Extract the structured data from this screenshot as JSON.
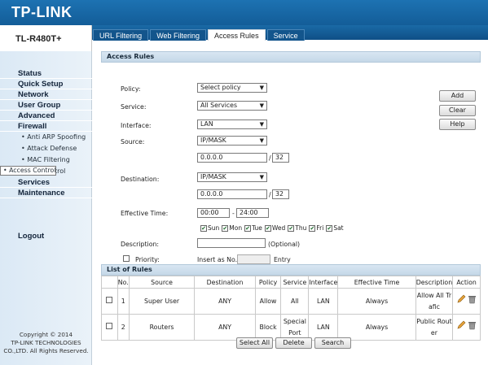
{
  "brand": {
    "logo": "TP-LINK",
    "model": "TL-R480T+"
  },
  "tabs": [
    "URL Filtering",
    "Web Filtering",
    "Access Rules",
    "Service"
  ],
  "sidebar": {
    "items": [
      {
        "label": "Status"
      },
      {
        "label": "Quick Setup"
      },
      {
        "label": "Network"
      },
      {
        "label": "User Group"
      },
      {
        "label": "Advanced"
      },
      {
        "label": "Firewall"
      },
      {
        "label": "• Anti ARP Spoofing"
      },
      {
        "label": "• Attack Defense"
      },
      {
        "label": "• MAC Filtering"
      },
      {
        "label": "• Access Control"
      },
      {
        "label": "• App Control"
      },
      {
        "label": "Services"
      },
      {
        "label": "Maintenance"
      }
    ],
    "logout": "Logout",
    "copyright": [
      "Copyright © 2014",
      "TP-LINK TECHNOLOGIES",
      "CO.,LTD. All Rights Reserved."
    ]
  },
  "access_rules": {
    "title": "Access Rules",
    "policy_label": "Policy:",
    "policy_value": "Select policy",
    "service_label": "Service:",
    "service_value": "All Services",
    "interface_label": "Interface:",
    "interface_value": "LAN",
    "source_label": "Source:",
    "source_type": "IP/MASK",
    "source_ip": "0.0.0.0",
    "source_mask": "32",
    "dest_label": "Destination:",
    "dest_type": "IP/MASK",
    "dest_ip": "0.0.0.0",
    "dest_mask": "32",
    "slash": "/",
    "time_label": "Effective Time:",
    "time_start": "00:00",
    "time_dash": "-",
    "time_end": "24:00",
    "days": [
      "Sun",
      "Mon",
      "Tue",
      "Wed",
      "Thu",
      "Fri",
      "Sat"
    ],
    "desc_label": "Description:",
    "desc_optional": "(Optional)",
    "priority_label": "Priority:",
    "insert_label": "Insert as No.",
    "entry_label": "Entry",
    "buttons": {
      "add": "Add",
      "clear": "Clear",
      "help": "Help"
    }
  },
  "rules": {
    "title": "List of Rules",
    "headers": [
      "No.",
      "Source",
      "Destination",
      "Policy",
      "Service",
      "Interface",
      "Effective Time",
      "Description",
      "Action"
    ],
    "rows": [
      {
        "no": "1",
        "source": "Super User",
        "destination": "ANY",
        "policy": "Allow",
        "service": "All",
        "interface": "LAN",
        "time": "Always",
        "description": "Allow All Trafic"
      },
      {
        "no": "2",
        "source": "Routers",
        "destination": "ANY",
        "policy": "Block",
        "service": "Special Port",
        "interface": "LAN",
        "time": "Always",
        "description": "Public Router"
      }
    ],
    "buttons": {
      "select_all": "Select All",
      "delete": "Delete",
      "search": "Search"
    }
  },
  "icons": {
    "edit": "pencil-icon",
    "delete": "trash-icon",
    "dropdown": "chevron-down-icon"
  }
}
